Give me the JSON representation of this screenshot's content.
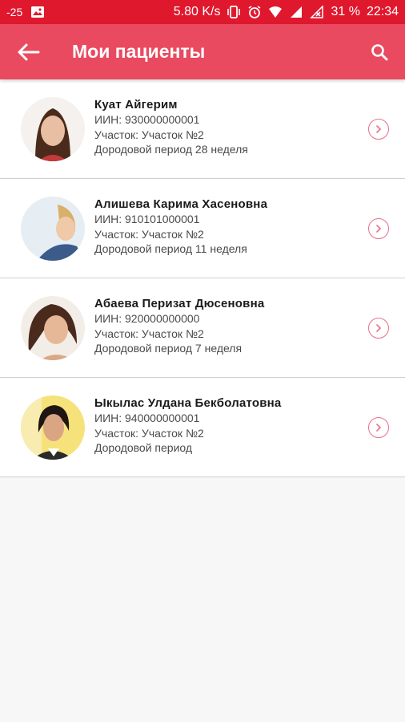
{
  "status_bar": {
    "temperature": "-25",
    "network_speed": "5.80 K/s",
    "battery": "31 %",
    "time": "22:34",
    "icons": [
      "temperature-icon",
      "image-icon",
      "vibrate-icon",
      "alarm-icon",
      "wifi-icon",
      "signal-icon",
      "no-signal-icon"
    ]
  },
  "app_bar": {
    "title": "Мои пациенты",
    "back_icon": "arrow-left-icon",
    "search_icon": "search-icon"
  },
  "colors": {
    "status_bar": "#e0182e",
    "app_bar": "#e94a5f",
    "accent": "#e8708a",
    "background": "#f7f7f7"
  },
  "patients": [
    {
      "name": "Куат Айгерим",
      "iin": "ИИН: 930000000001",
      "district": "Участок: Участок №2",
      "period": "Дородовой период 28 неделя"
    },
    {
      "name": "Алишева Карима Хасеновна",
      "iin": "ИИН: 910101000001",
      "district": "Участок: Участок №2",
      "period": "Дородовой период 11 неделя"
    },
    {
      "name": "Абаева Перизат Дюсеновна",
      "iin": "ИИН: 920000000000",
      "district": "Участок: Участок №2",
      "period": "Дородовой период 7 неделя"
    },
    {
      "name": "Ыкылас Улдана Бекболатовна",
      "iin": "ИИН: 940000000001",
      "district": "Участок: Участок №2",
      "period": "Дородовой период"
    }
  ]
}
